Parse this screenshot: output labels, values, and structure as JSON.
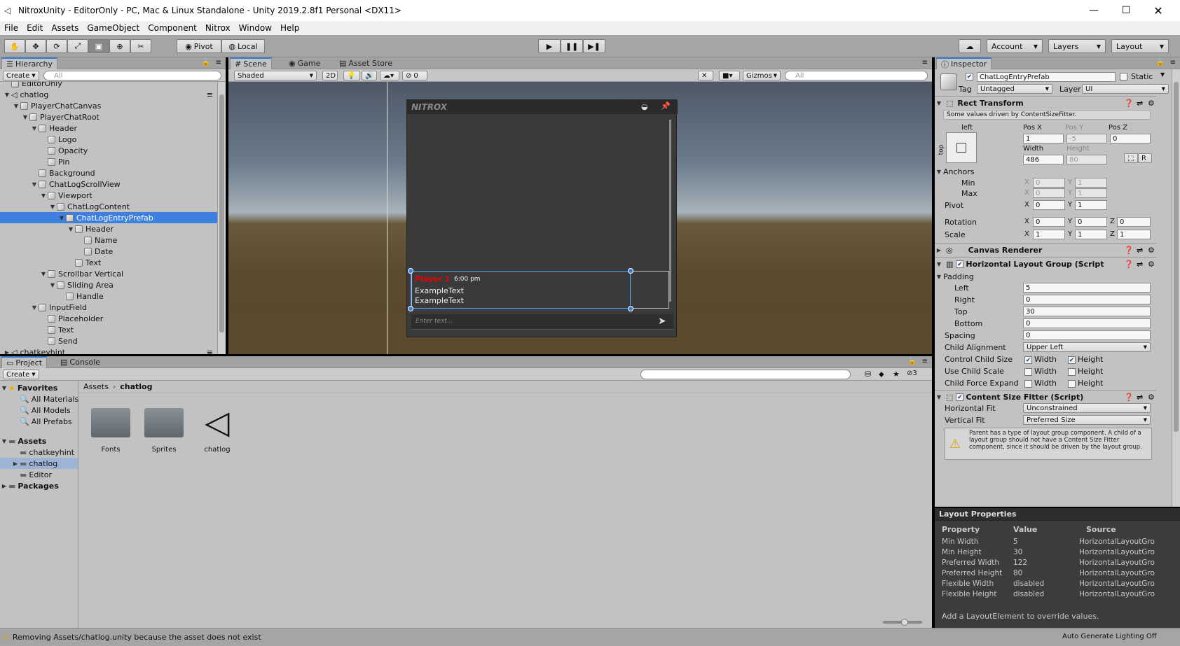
{
  "window": {
    "title": "NitroxUnity - EditorOnly - PC, Mac & Linux Standalone - Unity 2019.2.8f1 Personal <DX11>"
  },
  "menu": [
    "File",
    "Edit",
    "Assets",
    "GameObject",
    "Component",
    "Nitrox",
    "Window",
    "Help"
  ],
  "toolbar": {
    "pivot": "Pivot",
    "local": "Local",
    "account": "Account",
    "layers": "Layers",
    "layout": "Layout"
  },
  "hierarchy": {
    "tab": "Hierarchy",
    "create": "Create",
    "search_placeholder": "All",
    "items": [
      {
        "label": "EditorOnly",
        "depth": 1,
        "arrow": ""
      },
      {
        "label": "chatlog",
        "depth": 1,
        "arrow": "down",
        "scene": true
      },
      {
        "label": "PlayerChatCanvas",
        "depth": 2,
        "arrow": "down"
      },
      {
        "label": "PlayerChatRoot",
        "depth": 3,
        "arrow": "down"
      },
      {
        "label": "Header",
        "depth": 4,
        "arrow": "down"
      },
      {
        "label": "Logo",
        "depth": 5,
        "arrow": ""
      },
      {
        "label": "Opacity",
        "depth": 5,
        "arrow": ""
      },
      {
        "label": "Pin",
        "depth": 5,
        "arrow": ""
      },
      {
        "label": "Background",
        "depth": 4,
        "arrow": ""
      },
      {
        "label": "ChatLogScrollView",
        "depth": 4,
        "arrow": "down"
      },
      {
        "label": "Viewport",
        "depth": 5,
        "arrow": "down"
      },
      {
        "label": "ChatLogContent",
        "depth": 6,
        "arrow": "down"
      },
      {
        "label": "ChatLogEntryPrefab",
        "depth": 7,
        "arrow": "down",
        "selected": true
      },
      {
        "label": "Header",
        "depth": 8,
        "arrow": "down"
      },
      {
        "label": "Name",
        "depth": 9,
        "arrow": ""
      },
      {
        "label": "Date",
        "depth": 9,
        "arrow": ""
      },
      {
        "label": "Text",
        "depth": 8,
        "arrow": ""
      },
      {
        "label": "Scrollbar Vertical",
        "depth": 5,
        "arrow": "down"
      },
      {
        "label": "Sliding Area",
        "depth": 6,
        "arrow": "down"
      },
      {
        "label": "Handle",
        "depth": 7,
        "arrow": ""
      },
      {
        "label": "InputField",
        "depth": 4,
        "arrow": "down"
      },
      {
        "label": "Placeholder",
        "depth": 5,
        "arrow": ""
      },
      {
        "label": "Text",
        "depth": 5,
        "arrow": ""
      },
      {
        "label": "Send",
        "depth": 5,
        "arrow": ""
      },
      {
        "label": "chatkeyhint",
        "depth": 1,
        "arrow": "right",
        "scene": true
      }
    ]
  },
  "scene": {
    "tabs": [
      "Scene",
      "Game",
      "Asset Store"
    ],
    "shading": "Shaded",
    "mode2d": "2D",
    "hidden_count": "0",
    "gizmos": "Gizmos",
    "search_placeholder": "All",
    "chat": {
      "logo": "NITROX",
      "player": "Player 1",
      "time": "6:00 pm",
      "line1": "ExampleText",
      "line2": "ExampleText",
      "input_placeholder": "Enter text..."
    }
  },
  "project": {
    "tabs": [
      "Project",
      "Console"
    ],
    "create": "Create",
    "hidden_count": "3",
    "favorites_label": "Favorites",
    "favorites": [
      "All Materials",
      "All Models",
      "All Prefabs"
    ],
    "assets_label": "Assets",
    "assets": [
      "chatkeyhint",
      "chatlog",
      "Editor"
    ],
    "packages_label": "Packages",
    "breadcrumb": [
      "Assets",
      "chatlog"
    ],
    "files": [
      {
        "name": "Fonts",
        "kind": "folder"
      },
      {
        "name": "Sprites",
        "kind": "folder"
      },
      {
        "name": "chatlog",
        "kind": "unity"
      }
    ]
  },
  "inspector": {
    "tab": "Inspector",
    "object_name": "ChatLogEntryPrefab",
    "static_label": "Static",
    "tag_label": "Tag",
    "tag": "Untagged",
    "layer_label": "Layer",
    "layer": "UI",
    "rect": {
      "title": "Rect Transform",
      "note": "Some values driven by ContentSizeFitter.",
      "anchor_h": "left",
      "anchor_v": "top",
      "posx_label": "Pos X",
      "posy_label": "Pos Y",
      "posz_label": "Pos Z",
      "posx": "1",
      "posy": "-5",
      "posz": "0",
      "width_label": "Width",
      "height_label": "Height",
      "width": "486",
      "height": "80",
      "anchors_label": "Anchors",
      "min_label": "Min",
      "max_label": "Max",
      "min_x": "0",
      "min_y": "1",
      "max_x": "0",
      "max_y": "1",
      "pivot_label": "Pivot",
      "pivot_x": "0",
      "pivot_y": "1",
      "rotation_label": "Rotation",
      "rot_x": "0",
      "rot_y": "0",
      "rot_z": "0",
      "scale_label": "Scale",
      "scale_x": "1",
      "scale_y": "1",
      "scale_z": "1",
      "r_button": "R"
    },
    "canvas_renderer": "Canvas Renderer",
    "hlg": {
      "title": "Horizontal Layout Group (Script",
      "padding": "Padding",
      "left_label": "Left",
      "right_label": "Right",
      "top_label": "Top",
      "bottom_label": "Bottom",
      "left": "5",
      "right": "0",
      "top": "30",
      "bottom": "0",
      "spacing_label": "Spacing",
      "spacing": "0",
      "child_alignment_label": "Child Alignment",
      "child_alignment": "Upper Left",
      "control_label": "Control Child Size",
      "use_scale_label": "Use Child Scale",
      "force_label": "Child Force Expand",
      "width_opt": "Width",
      "height_opt": "Height"
    },
    "csf": {
      "title": "Content Size Fitter (Script)",
      "hfit_label": "Horizontal Fit",
      "hfit": "Unconstrained",
      "vfit_label": "Vertical Fit",
      "vfit": "Preferred Size",
      "warning": "Parent has a type of layout group component. A child of a layout group should not have a Content Size Fitter component, since it should be driven by the layout group."
    },
    "layout_props": {
      "title": "Layout Properties",
      "headers": [
        "Property",
        "Value",
        "Source"
      ],
      "rows": [
        [
          "Min Width",
          "5",
          "HorizontalLayoutGro"
        ],
        [
          "Min Height",
          "30",
          "HorizontalLayoutGro"
        ],
        [
          "Preferred Width",
          "122",
          "HorizontalLayoutGro"
        ],
        [
          "Preferred Height",
          "80",
          "HorizontalLayoutGro"
        ],
        [
          "Flexible Width",
          "disabled",
          "HorizontalLayoutGro"
        ],
        [
          "Flexible Height",
          "disabled",
          "HorizontalLayoutGro"
        ]
      ],
      "footer": "Add a LayoutElement to override values."
    }
  },
  "status": {
    "message": "Removing Assets/chatlog.unity because the asset does not exist",
    "lighting": "Auto Generate Lighting Off"
  }
}
